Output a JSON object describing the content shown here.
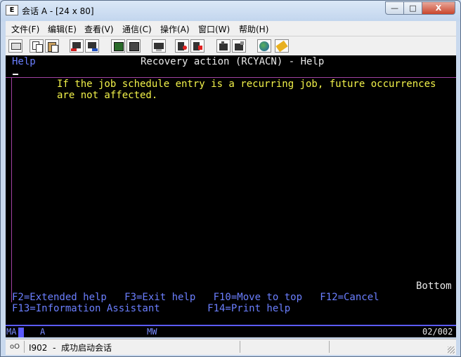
{
  "window": {
    "title_icon": "E",
    "title": "会话 A - [24 x 80]",
    "controls": {
      "minimize": "—",
      "maximize": "□",
      "close": "X"
    }
  },
  "menu": [
    "文件(F)",
    "编辑(E)",
    "查看(V)",
    "通信(C)",
    "操作(A)",
    "窗口(W)",
    "帮助(H)"
  ],
  "toolbar": {
    "icons": [
      "print-screen-icon",
      "copy-icon",
      "paste-icon",
      "send-file-icon",
      "receive-file-icon",
      "display-icon",
      "keypad-icon",
      "record-macro-icon",
      "play-macro-icon",
      "stop-macro-icon",
      "macro-edit-icon",
      "macro-run-icon",
      "globe-icon",
      "help-icon"
    ]
  },
  "terminal": {
    "header_left": "Help",
    "header_title": "Recovery action (RCYACN) - Help",
    "body_line1": "If the job schedule entry is a recurring job, future occurrences",
    "body_line2": "are not affected.",
    "bottom": "Bottom",
    "fkeys_line1": "F2=Extended help   F3=Exit help   F10=Move to top   F12=Cancel",
    "fkeys_line2": "F13=Information Assistant        F14=Print help"
  },
  "oia": {
    "ma": "MA",
    "session": "A",
    "mw": "MW",
    "position": "02/002"
  },
  "status": {
    "icon": "oO",
    "text": "I902  -  成功启动会话"
  }
}
